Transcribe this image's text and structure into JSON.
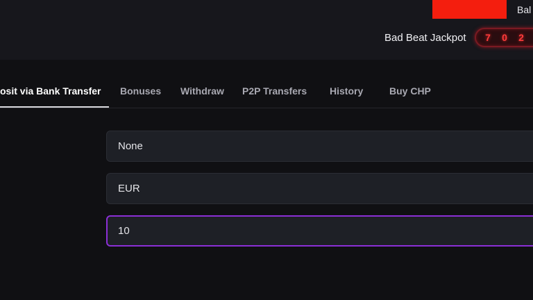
{
  "header": {
    "balance_label": "Bal",
    "jackpot_label": "Bad Beat Jackpot",
    "jackpot_digits": [
      "7",
      "0",
      "2"
    ],
    "colors": {
      "brand_red": "#f41e0e",
      "jackpot_red": "#ff3b3b"
    }
  },
  "tabs": [
    {
      "label": "osit via Bank Transfer",
      "active": true
    },
    {
      "label": "Bonuses",
      "active": false
    },
    {
      "label": "Withdraw",
      "active": false
    },
    {
      "label": "P2P Transfers",
      "active": false
    },
    {
      "label": "History",
      "active": false
    },
    {
      "label": "Buy CHP",
      "active": false
    }
  ],
  "form": {
    "bonus_select_value": "None",
    "currency_value": "EUR",
    "amount_value": "10",
    "focus_color": "#8b2fd6"
  }
}
